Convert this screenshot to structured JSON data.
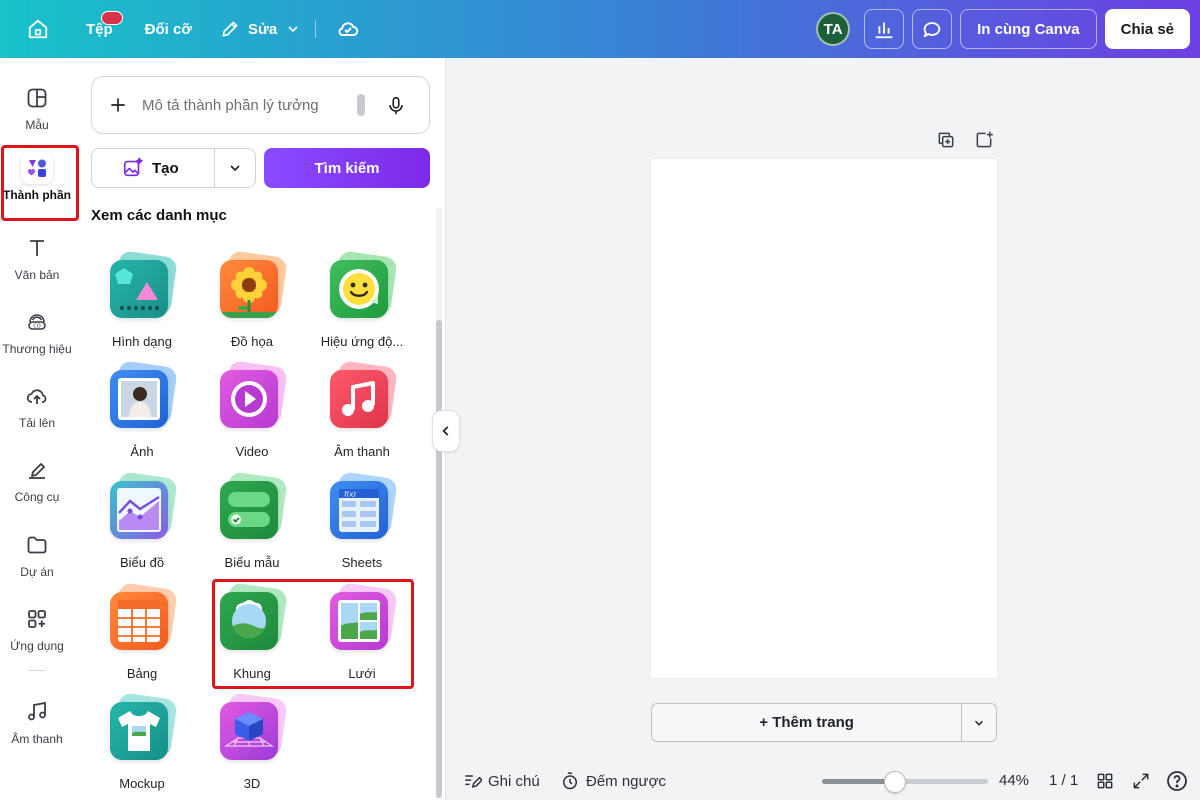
{
  "topbar": {
    "file_label": "Tệp",
    "resize_label": "Đổi cỡ",
    "edit_label": "Sửa",
    "avatar_initials": "TA",
    "print_label": "In cùng Canva",
    "share_label": "Chia sẻ"
  },
  "rail": {
    "items": [
      {
        "label": "Mẫu",
        "icon": "template-icon"
      },
      {
        "label": "Thành phần",
        "icon": "elements-icon"
      },
      {
        "label": "Văn bản",
        "icon": "text-icon"
      },
      {
        "label": "Thương hiệu",
        "icon": "brand-icon"
      },
      {
        "label": "Tải lên",
        "icon": "upload-icon"
      },
      {
        "label": "Công cụ",
        "icon": "tools-icon"
      },
      {
        "label": "Dự án",
        "icon": "folder-icon"
      },
      {
        "label": "Ứng dụng",
        "icon": "apps-icon"
      },
      {
        "label": "Âm thanh",
        "icon": "music-icon"
      }
    ]
  },
  "panel": {
    "search_placeholder": "Mô tả thành phần lý tưởng",
    "generate_label": "Tạo",
    "search_button": "Tìm kiếm",
    "section_title": "Xem các danh mục",
    "categories": [
      {
        "label": "Hình dạng"
      },
      {
        "label": "Đồ họa"
      },
      {
        "label": "Hiệu ứng độ..."
      },
      {
        "label": "Ảnh"
      },
      {
        "label": "Video"
      },
      {
        "label": "Âm thanh"
      },
      {
        "label": "Biểu đồ"
      },
      {
        "label": "Biểu mẫu"
      },
      {
        "label": "Sheets"
      },
      {
        "label": "Bảng"
      },
      {
        "label": "Khung"
      },
      {
        "label": "Lưới"
      },
      {
        "label": "Mockup"
      },
      {
        "label": "3D"
      }
    ]
  },
  "canvas": {
    "add_page_label": "+ Thêm trang"
  },
  "bottombar": {
    "notes_label": "Ghi chú",
    "timer_label": "Đếm ngược",
    "zoom_label": "44%",
    "zoom_value": 0.44,
    "page_counter": "1 / 1"
  }
}
